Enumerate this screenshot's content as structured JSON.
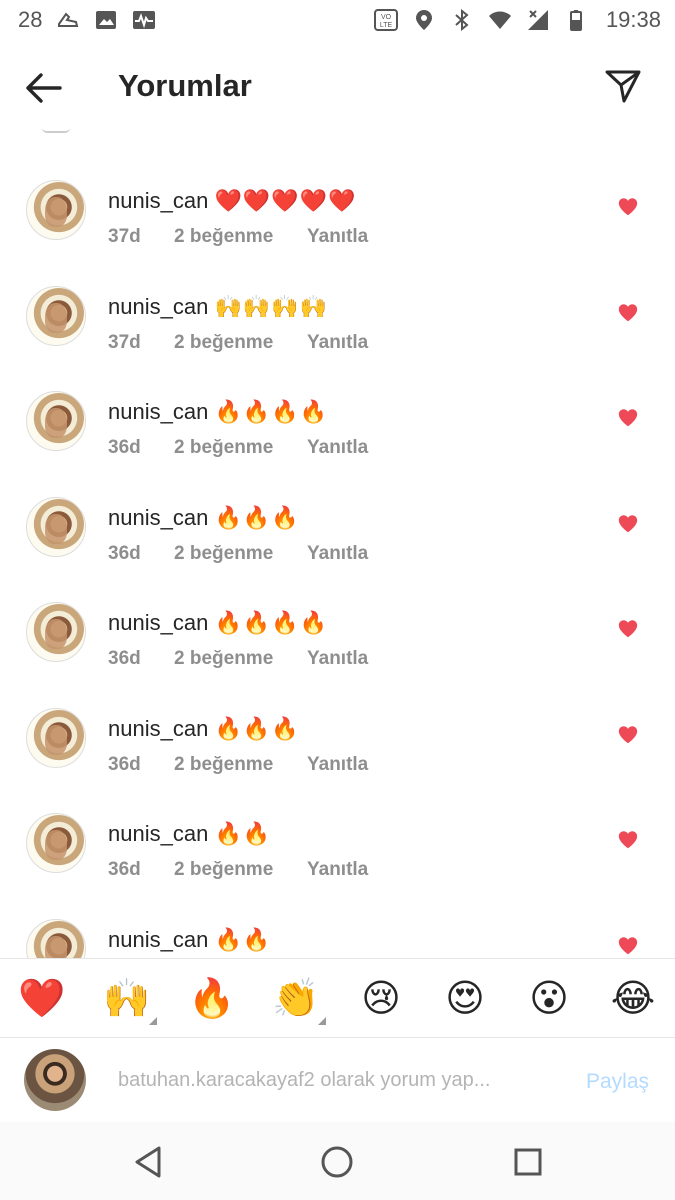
{
  "status_bar": {
    "left_number": "28",
    "time": "19:38",
    "icons": [
      "sneaker-icon",
      "image-icon",
      "activity-icon",
      "volte-icon",
      "location-icon",
      "bluetooth-icon",
      "wifi-icon",
      "no-signal-icon",
      "battery-icon"
    ]
  },
  "header": {
    "title": "Yorumlar",
    "back_icon": "arrow-left-icon",
    "send_icon": "paper-plane-icon"
  },
  "comments": [
    {
      "username": "nunis_can",
      "emoji": "❤️❤️❤️❤️❤️",
      "time": "37d",
      "likes": "2 beğenme",
      "reply": "Yanıtla"
    },
    {
      "username": "nunis_can",
      "emoji": "🙌🙌🙌🙌",
      "time": "37d",
      "likes": "2 beğenme",
      "reply": "Yanıtla"
    },
    {
      "username": "nunis_can",
      "emoji": "🔥🔥🔥🔥",
      "time": "36d",
      "likes": "2 beğenme",
      "reply": "Yanıtla"
    },
    {
      "username": "nunis_can",
      "emoji": "🔥🔥🔥",
      "time": "36d",
      "likes": "2 beğenme",
      "reply": "Yanıtla"
    },
    {
      "username": "nunis_can",
      "emoji": "🔥🔥🔥🔥",
      "time": "36d",
      "likes": "2 beğenme",
      "reply": "Yanıtla"
    },
    {
      "username": "nunis_can",
      "emoji": "🔥🔥🔥",
      "time": "36d",
      "likes": "2 beğenme",
      "reply": "Yanıtla"
    },
    {
      "username": "nunis_can",
      "emoji": "🔥🔥",
      "time": "36d",
      "likes": "2 beğenme",
      "reply": "Yanıtla"
    },
    {
      "username": "nunis_can",
      "emoji": "🔥🔥",
      "time": "",
      "likes": "",
      "reply": ""
    }
  ],
  "emoji_bar": [
    {
      "emoji": "❤️",
      "name": "heart"
    },
    {
      "emoji": "🙌",
      "name": "raising-hands"
    },
    {
      "emoji": "🔥",
      "name": "fire"
    },
    {
      "emoji": "👏",
      "name": "clapping-hands"
    },
    {
      "emoji": "😢",
      "name": "crying-face"
    },
    {
      "emoji": "😍",
      "name": "heart-eyes"
    },
    {
      "emoji": "😮",
      "name": "surprised-face"
    },
    {
      "emoji": "😂",
      "name": "tears-of-joy"
    }
  ],
  "input": {
    "placeholder": "batuhan.karacakayaf2 olarak yorum yap...",
    "share_label": "Paylaş"
  },
  "colors": {
    "heart": "#ed4956",
    "meta_text": "#8e8e8e",
    "share_disabled": "#b3dbff"
  }
}
